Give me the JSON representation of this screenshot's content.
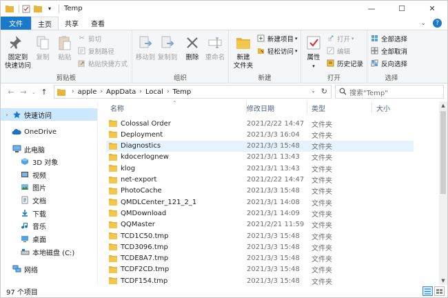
{
  "window": {
    "title": "Temp",
    "minimize_glyph": "—",
    "maximize_glyph": "☐",
    "close_glyph": "✕"
  },
  "ribbon_tabs": [
    {
      "label": "文件"
    },
    {
      "label": "主页"
    },
    {
      "label": "共享"
    },
    {
      "label": "查看"
    }
  ],
  "ribbon": {
    "clipboard": {
      "label": "剪贴板",
      "pin": "固定到\n快速访问",
      "copy": "复制",
      "paste": "粘贴",
      "cut": "剪切",
      "copy_path": "复制路径",
      "paste_shortcut": "粘贴快捷方式"
    },
    "organize": {
      "label": "组织",
      "move_to": "移动到",
      "copy_to": "复制到",
      "delete": "删除",
      "rename": "重命名"
    },
    "new": {
      "label": "新建",
      "new_folder": "新建\n文件夹",
      "new_item": "新建项目",
      "easy_access": "轻松访问"
    },
    "open": {
      "label": "打开",
      "properties": "属性",
      "open": "打开",
      "edit": "编辑",
      "history": "历史记录"
    },
    "select": {
      "label": "选择",
      "select_all": "全部选择",
      "select_none": "全部取消",
      "invert": "反向选择"
    }
  },
  "address": {
    "crumbs": [
      "apple",
      "AppData",
      "Local",
      "Temp"
    ],
    "search_placeholder": "搜索\"Temp\""
  },
  "nav": {
    "quick_access": "快速访问",
    "onedrive": "OneDrive",
    "this_pc": "此电脑",
    "objects3d": "3D 对象",
    "videos": "视频",
    "pictures": "图片",
    "documents": "文档",
    "downloads": "下载",
    "music": "音乐",
    "desktop": "桌面",
    "local_disk": "本地磁盘 (C:)",
    "network": "网络"
  },
  "columns": {
    "name": "名称",
    "modified": "修改日期",
    "type": "类型",
    "size": "大小"
  },
  "files": [
    {
      "name": "Colossal Order",
      "modified": "2021/2/22 14:47",
      "type": "文件夹"
    },
    {
      "name": "Deployment",
      "modified": "2021/3/3 16:04",
      "type": "文件夹"
    },
    {
      "name": "Diagnostics",
      "modified": "2021/3/3 15:48",
      "type": "文件夹"
    },
    {
      "name": "kdocerlognew",
      "modified": "2021/3/1 13:43",
      "type": "文件夹"
    },
    {
      "name": "klog",
      "modified": "2021/3/1 13:43",
      "type": "文件夹"
    },
    {
      "name": "net-export",
      "modified": "2021/2/22 14:47",
      "type": "文件夹"
    },
    {
      "name": "PhotoCache",
      "modified": "2021/3/3 15:48",
      "type": "文件夹"
    },
    {
      "name": "QMDLCenter_121_2_1",
      "modified": "2021/3/1 14:08",
      "type": "文件夹"
    },
    {
      "name": "QMDownload",
      "modified": "2021/3/1 14:09",
      "type": "文件夹"
    },
    {
      "name": "QQMaster",
      "modified": "2021/2/21 11:59",
      "type": "文件夹"
    },
    {
      "name": "TCD1C50.tmp",
      "modified": "2021/3/3 15:48",
      "type": "文件夹"
    },
    {
      "name": "TCD3096.tmp",
      "modified": "2021/3/3 15:48",
      "type": "文件夹"
    },
    {
      "name": "TCDE8A7.tmp",
      "modified": "2021/3/3 15:48",
      "type": "文件夹"
    },
    {
      "name": "TCDF2CD.tmp",
      "modified": "2021/3/3 15:48",
      "type": "文件夹"
    },
    {
      "name": "TCDF154.tmp",
      "modified": "2021/3/3 15:48",
      "type": "文件夹"
    }
  ],
  "status": {
    "count": "97 个项目"
  },
  "colors": {
    "accent": "#1979ca",
    "folder": "#e8b53a",
    "selection": "#cce8ff"
  }
}
